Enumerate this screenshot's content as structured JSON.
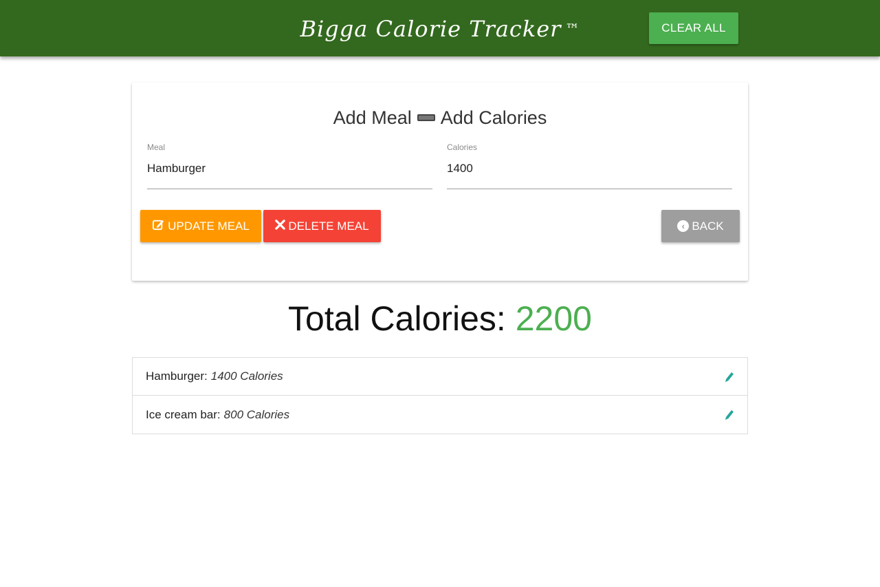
{
  "header": {
    "brand": "Bigga Calorie Tracker",
    "trademark": "™",
    "clear_all_label": "CLEAR ALL"
  },
  "form": {
    "title_left": "Add Meal",
    "title_right": "Add Calories",
    "meal_label": "Meal",
    "meal_value": "Hamburger",
    "calories_label": "Calories",
    "calories_value": "1400",
    "update_label": "UPDATE MEAL",
    "delete_label": "DELETE MEAL",
    "back_label": "BACK"
  },
  "total": {
    "label": "Total Calories:",
    "value": "2200"
  },
  "meals": [
    {
      "name": "Hamburger:",
      "calories": "1400 Calories"
    },
    {
      "name": "Ice cream bar:",
      "calories": "800 Calories"
    }
  ],
  "colors": {
    "header_bg": "#33691e",
    "clear_button": "#4caf50",
    "update_button": "#ff9800",
    "delete_button": "#f44336",
    "back_button": "#9e9e9e",
    "total_value": "#4caf50",
    "edit_icon": "#26a69a"
  },
  "icons": {
    "title_separator": "minus-icon",
    "update": "edit-icon",
    "delete": "close-icon",
    "back": "chevron-left-circle-icon",
    "meal_edit": "pencil-icon"
  }
}
